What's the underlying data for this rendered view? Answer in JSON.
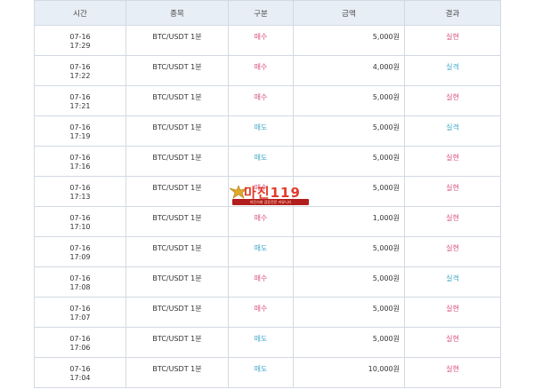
{
  "table": {
    "headers": [
      "시간",
      "종목",
      "구분",
      "금액",
      "결과"
    ],
    "rows": [
      {
        "date": "07-16",
        "time": "17:29",
        "symbol": "BTC/USDT 1분",
        "side": "매수",
        "amount": "5,000원",
        "result": "실현"
      },
      {
        "date": "07-16",
        "time": "17:22",
        "symbol": "BTC/USDT 1분",
        "side": "매수",
        "amount": "4,000원",
        "result": "실격"
      },
      {
        "date": "07-16",
        "time": "17:21",
        "symbol": "BTC/USDT 1분",
        "side": "매수",
        "amount": "5,000원",
        "result": "실현"
      },
      {
        "date": "07-16",
        "time": "17:19",
        "symbol": "BTC/USDT 1분",
        "side": "매도",
        "amount": "5,000원",
        "result": "실격"
      },
      {
        "date": "07-16",
        "time": "17:16",
        "symbol": "BTC/USDT 1분",
        "side": "매도",
        "amount": "5,000원",
        "result": "실현"
      },
      {
        "date": "07-16",
        "time": "17:13",
        "symbol": "BTC/USDT 1분",
        "side": "매수",
        "amount": "5,000원",
        "result": "실현"
      },
      {
        "date": "07-16",
        "time": "17:10",
        "symbol": "BTC/USDT 1분",
        "side": "매수",
        "amount": "1,000원",
        "result": "실현"
      },
      {
        "date": "07-16",
        "time": "17:09",
        "symbol": "BTC/USDT 1분",
        "side": "매도",
        "amount": "5,000원",
        "result": "실현"
      },
      {
        "date": "07-16",
        "time": "17:08",
        "symbol": "BTC/USDT 1분",
        "side": "매수",
        "amount": "5,000원",
        "result": "실격"
      },
      {
        "date": "07-16",
        "time": "17:07",
        "symbol": "BTC/USDT 1분",
        "side": "매수",
        "amount": "5,000원",
        "result": "실현"
      },
      {
        "date": "07-16",
        "time": "17:06",
        "symbol": "BTC/USDT 1분",
        "side": "매도",
        "amount": "5,000원",
        "result": "실현"
      },
      {
        "date": "07-16",
        "time": "17:04",
        "symbol": "BTC/USDT 1분",
        "side": "매도",
        "amount": "10,000원",
        "result": "실현"
      }
    ]
  },
  "watermark": {
    "brand": "마진119",
    "tagline": "마진거래 검증전문 커뮤니티"
  },
  "colors": {
    "buy": "#d8507a",
    "sell": "#3fa7c9",
    "header_bg": "#e8eef6",
    "border": "#d3d9e2"
  }
}
